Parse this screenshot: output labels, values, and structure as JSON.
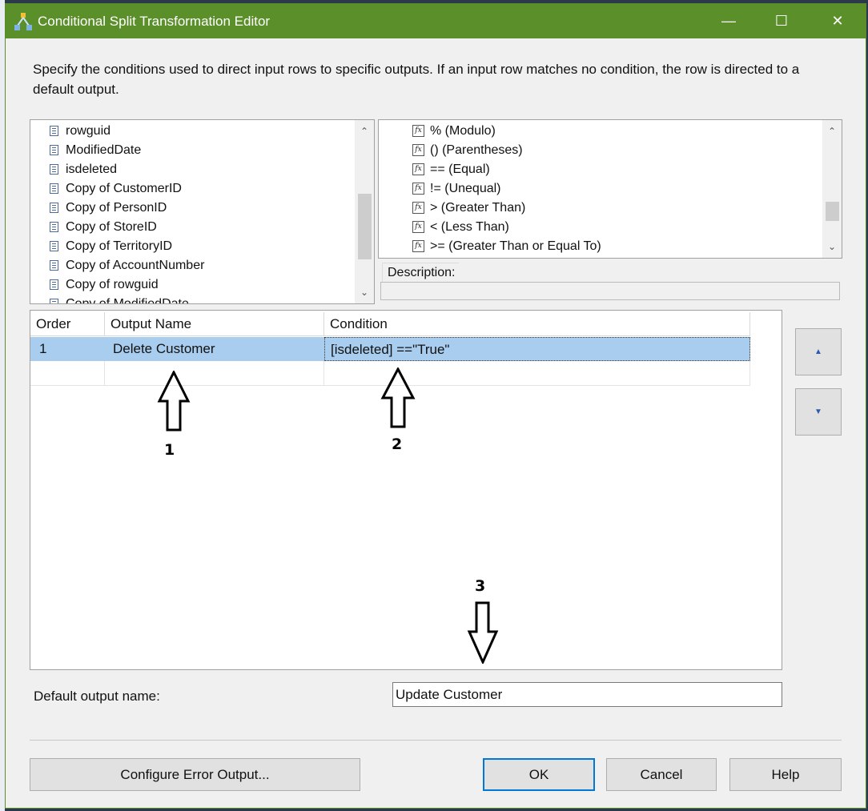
{
  "window": {
    "title": "Conditional Split Transformation Editor",
    "minimize_glyph": "—",
    "maximize_glyph": "☐",
    "close_glyph": "✕",
    "accent_color": "#5a8f29"
  },
  "description": "Specify the conditions used to direct input rows to specific outputs. If an input row matches no condition, the row is directed to a default output.",
  "columns_tree": {
    "items": [
      "rowguid",
      "ModifiedDate",
      "isdeleted",
      "Copy of CustomerID",
      "Copy of PersonID",
      "Copy of StoreID",
      "Copy of TerritoryID",
      "Copy of AccountNumber",
      "Copy of rowguid",
      "Copy of ModifiedDate"
    ]
  },
  "functions_tree": {
    "items": [
      "% (Modulo)",
      "() (Parentheses)",
      "== (Equal)",
      "!= (Unequal)",
      "> (Greater Than)",
      "< (Less Than)",
      ">= (Greater Than or Equal To)"
    ],
    "icon_glyph": "fx"
  },
  "description_panel": {
    "label": "Description:",
    "value": ""
  },
  "conditions_grid": {
    "headers": {
      "order": "Order",
      "output_name": "Output Name",
      "condition": "Condition"
    },
    "rows": [
      {
        "order": "1",
        "output_name": "Delete Customer",
        "condition": "[isdeleted] ==\"True\""
      }
    ]
  },
  "annotations": {
    "one": "1",
    "two": "2",
    "three": "3"
  },
  "side_buttons": {
    "up_glyph": "▲",
    "down_glyph": "▼"
  },
  "default_output": {
    "label": "Default output name:",
    "value": "Update Customer"
  },
  "buttons": {
    "configure_error": "Configure Error Output...",
    "ok": "OK",
    "cancel": "Cancel",
    "help": "Help"
  },
  "scroll_glyphs": {
    "up": "⌃",
    "down": "⌄"
  }
}
